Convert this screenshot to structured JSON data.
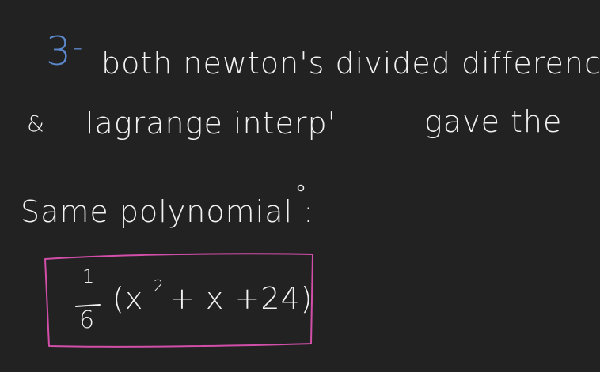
{
  "colors": {
    "background": "#222222",
    "ink": "#f2f2f2",
    "number": "#5b86c7",
    "box": "#d14fa8"
  },
  "note": {
    "item_number": "3",
    "item_sep": "-",
    "line1_rest": "both newton's divided difference",
    "line2_prefix": "&",
    "line2_text": "lagrange interp'",
    "line2_suffix": "gave the",
    "line3_text": "Same polynomial :",
    "answer": {
      "frac_num": "1",
      "frac_den": "6",
      "expr_open": "(x",
      "exponent": "2",
      "expr_rest": "+ x +24)"
    }
  }
}
